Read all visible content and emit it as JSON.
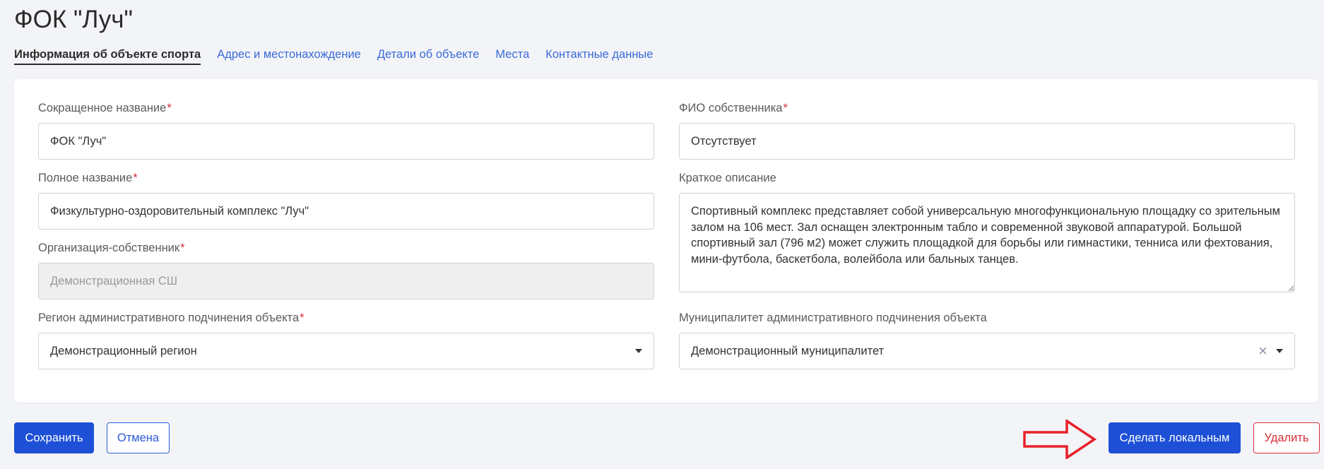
{
  "page": {
    "title": "ФОК \"Луч\""
  },
  "tabs": [
    {
      "label": "Информация об объекте спорта",
      "active": true
    },
    {
      "label": "Адрес и местонахождение"
    },
    {
      "label": "Детали об объекте"
    },
    {
      "label": "Места"
    },
    {
      "label": "Контактные данные"
    }
  ],
  "form": {
    "short_name": {
      "label": "Сокращенное название",
      "required_mark": "*",
      "value": "ФОК \"Луч\""
    },
    "full_name": {
      "label": "Полное название",
      "required_mark": "*",
      "value": "Физкультурно-оздоровительный комплекс \"Луч\""
    },
    "owner_org": {
      "label": "Организация-собственник",
      "required_mark": "*",
      "value": "Демонстрационная СШ"
    },
    "region": {
      "label": "Регион административного подчинения объекта",
      "required_mark": "*",
      "value": "Демонстрационный регион"
    },
    "owner_name": {
      "label": "ФИО собственника",
      "required_mark": "*",
      "value": "Отсутствует"
    },
    "description": {
      "label": "Краткое описание",
      "value": "Спортивный комплекс представляет собой универсальную многофункциональную площадку со зрительным залом на 106 мест. Зал оснащен электронным табло и современной звуковой аппаратурой. Большой спортивный зал (796 м2) может служить площадкой для борьбы или гимнастики, тенниса или фехтования, мини-футбола, баскетбола, волейбола или бальных танцев."
    },
    "municipality": {
      "label": "Муниципалитет административного подчинения объекта",
      "value": "Демонстрационный муниципалитет",
      "clear_icon": "×"
    }
  },
  "actions": {
    "save": "Сохранить",
    "cancel": "Отмена",
    "make_local": "Сделать локальным",
    "delete": "Удалить"
  },
  "colors": {
    "primary": "#1d50d6",
    "link": "#3a6ad8",
    "danger": "#d9303a",
    "annotation_arrow": "#e8202a"
  },
  "icons": {
    "select_caret": "chevron-down-icon",
    "clear": "close-icon",
    "annotation": "right-arrow-outline-icon"
  }
}
